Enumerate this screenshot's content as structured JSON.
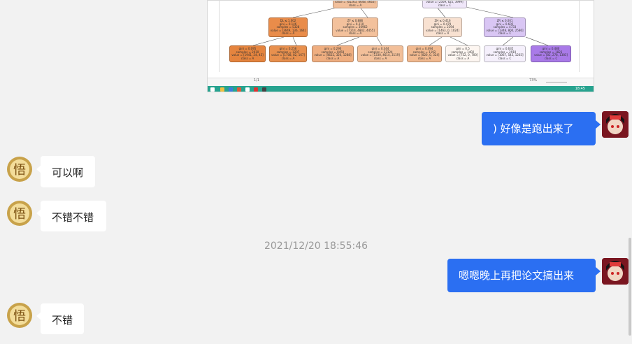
{
  "tree": {
    "top_left": "value = [65263, 6648, 4663]\nclass = A",
    "top_right": "value = [2569, 625, 3999]\nclass = C",
    "mid": [
      "DL ≤ 1.002\ngini = 0.146\nsamples = 5328\nvalue = [3649, 136, 164]\nclass = A",
      "ZF ≤ 0.886\ngini = 0.310\nsamples = 36962\nvalue = [7214, 4842, 4455]\nclass = A",
      "ZH ≤ 0.416\ngini = 0.479\nsamples = 2394\nvalue = [1463, 0, 1024]\nclass = A",
      "ZR ≤ 0.001\ngini = 0.605\nsamples = 4733\nvalue = [1348, 800, 2586]\nclass = C"
    ],
    "leaf": [
      "gini = 0.095\nsamples = 2010\nvalue = [1941, 24, 45]\nclass = A",
      "gini = 0.256\nsamples = 1207\nvalue = [1708, 82, 167]\nclass = A",
      "gini = 0.290\nsamples = 8459\nvalue = [4622, 320, 1288]\nclass = A",
      "gini = 0.344\nsamples = 23124\nvalue = [1330, 4614, 3119]\nclass = A",
      "gini = 0.494\nsamples = 1192\nvalue = [820, 0, 324]\nclass = A",
      "gini = 0.5\nsamples = 1402\nvalue = [752, 0, 700]\nclass = A",
      "gini = 0.635\nsamples = 2910\nvalue = [1067, 543, 1203]\nclass = C",
      "gini = 0.480\nsamples = 1823\nvalue = [82, 278, 1383]\nclass = C"
    ]
  },
  "pdfbar": {
    "page": "1/1",
    "zoom": "73%"
  },
  "taskbar": {
    "time": "18:45"
  },
  "messages": {
    "m1": ") 好像是跑出来了",
    "m2": "可以啊",
    "m3": "不错不错",
    "timestamp": "2021/12/20 18:55:46",
    "m4": "嗯嗯晚上再把论文搞出来",
    "m5": "不错"
  },
  "colors": {
    "accent": "#2b6ff2",
    "taskbar": "#27a38f"
  }
}
